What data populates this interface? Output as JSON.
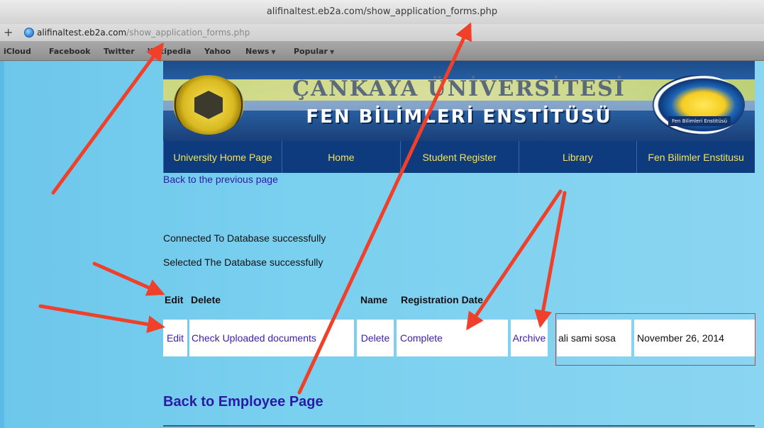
{
  "browser": {
    "window_title": "alifinaltest.eb2a.com/show_application_forms.php",
    "plus_label": "+",
    "url_host": "alifinaltest.eb2a.com",
    "url_path": "/show_application_forms.php",
    "bookmarks": [
      {
        "label": "iCloud",
        "has_menu": false
      },
      {
        "label": "Facebook",
        "has_menu": false
      },
      {
        "label": "Twitter",
        "has_menu": false
      },
      {
        "label": "Wikipedia",
        "has_menu": false
      },
      {
        "label": "Yahoo",
        "has_menu": false
      },
      {
        "label": "News",
        "has_menu": true
      },
      {
        "label": "Popular",
        "has_menu": true
      }
    ],
    "menu_caret": "▼"
  },
  "banner": {
    "title_line1": "ÇANKAYA ÜNİVERSİTESİ",
    "title_line2": "FEN BİLİMLERİ ENSTİTÜSÜ",
    "logo_right_text": "Fen Bilimleri Enstitüsü",
    "colors": {
      "navy": "#0e3a7e",
      "yellow": "#f4e35b"
    }
  },
  "nav": {
    "items": [
      "University Home Page",
      "Home",
      "Student Register",
      "Library",
      "Fen Bilimler Enstitusu"
    ]
  },
  "back_link": "Back to the previous page",
  "status": {
    "connected": "Connected To Database successfully",
    "selected": "Selected The Database successfully"
  },
  "table": {
    "headers": [
      "Edit",
      "Delete",
      "Name",
      "Registration Date"
    ],
    "row": {
      "edit": "Edit",
      "check_docs": "Check Uploaded documents",
      "delete": "Delete",
      "complete": "Complete",
      "archive": "Archive",
      "name": "ali sami sosa",
      "date": "November 26, 2014"
    }
  },
  "employee_link": "Back to Employee Page",
  "annotation_color": "#f0402a"
}
